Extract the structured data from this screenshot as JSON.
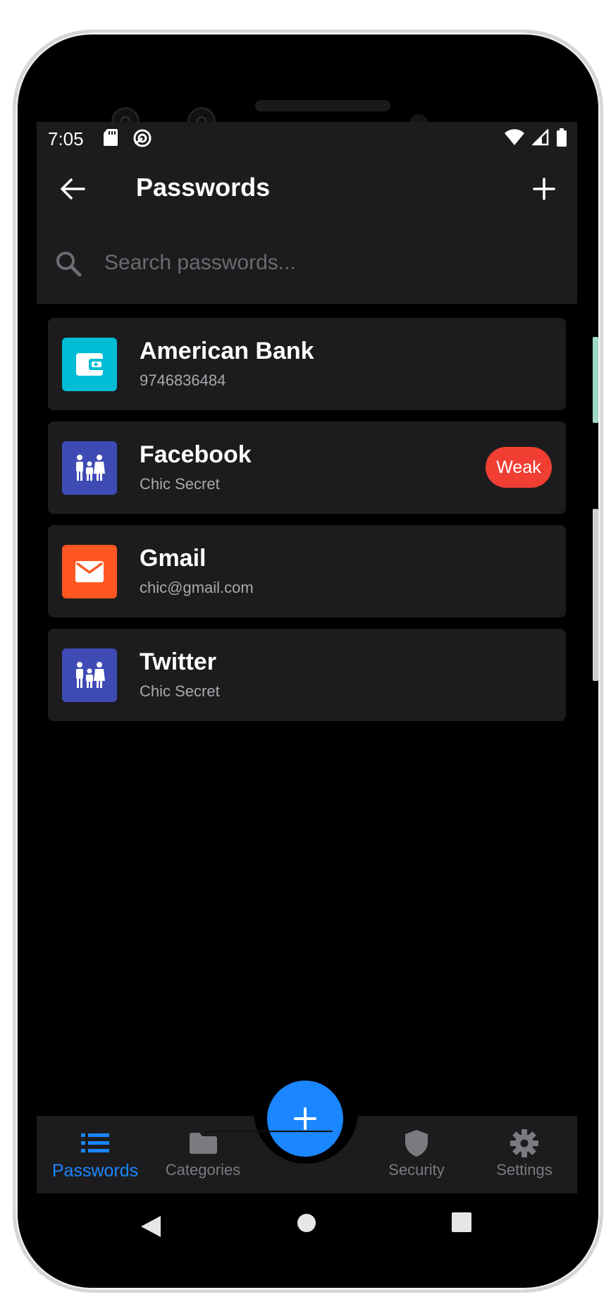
{
  "status_bar": {
    "time": "7:05",
    "icons_left": [
      "sd-card-icon",
      "sync-icon"
    ],
    "icons_right": [
      "wifi-icon",
      "signal-icon",
      "battery-icon"
    ]
  },
  "app_bar": {
    "title": "Passwords",
    "back_icon": "arrow-left-icon",
    "add_icon": "plus-icon"
  },
  "search": {
    "placeholder": "Search passwords...",
    "value": ""
  },
  "entries": [
    {
      "name": "American Bank",
      "subtitle": "9746836484",
      "icon": "wallet-icon",
      "color": "#00bcd4",
      "badge": ""
    },
    {
      "name": "Facebook",
      "subtitle": "Chic Secret",
      "icon": "family-icon",
      "color": "#3f4bb5",
      "badge": "Weak"
    },
    {
      "name": "Gmail",
      "subtitle": "chic@gmail.com",
      "icon": "mail-icon",
      "color": "#ff5722",
      "badge": ""
    },
    {
      "name": "Twitter",
      "subtitle": "Chic Secret",
      "icon": "family-icon",
      "color": "#3f4bb5",
      "badge": ""
    }
  ],
  "bottom_nav": {
    "items": [
      {
        "label": "Passwords",
        "icon": "list-icon",
        "active": true
      },
      {
        "label": "Categories",
        "icon": "folder-icon",
        "active": false
      },
      {
        "label": "Security",
        "icon": "shield-icon",
        "active": false
      },
      {
        "label": "Settings",
        "icon": "gear-icon",
        "active": false
      }
    ]
  },
  "fab": {
    "icon": "plus-icon"
  },
  "colors": {
    "accent": "#1a86ff",
    "surface": "#1c1c1e",
    "background": "#000000",
    "weak_badge": "#f03e33",
    "inactive": "#7a7a7f"
  }
}
